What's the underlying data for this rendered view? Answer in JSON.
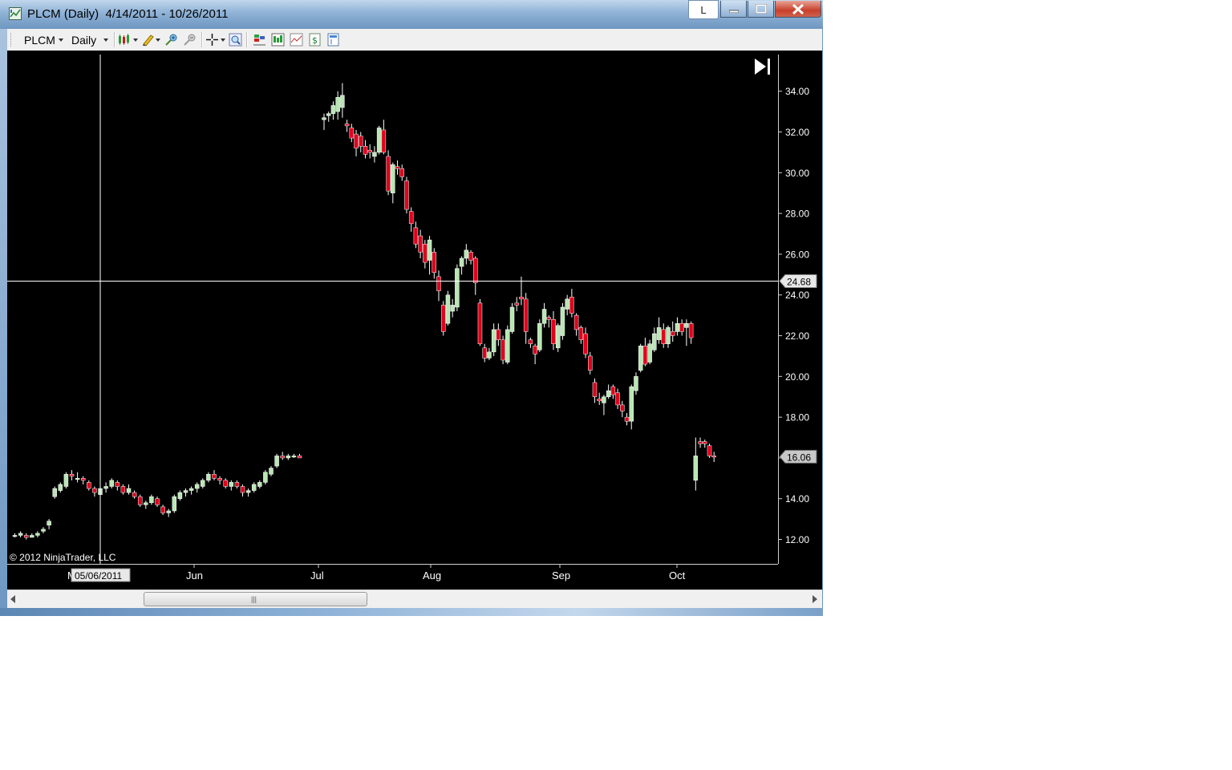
{
  "window": {
    "title": "PLCM (Daily)  4/14/2011 - 10/26/2011",
    "l_button_label": "L"
  },
  "toolbar": {
    "instrument": "PLCM",
    "interval": "Daily",
    "icons": [
      "chart-style-icon",
      "drawing-tools-icon",
      "zoom-in-icon",
      "zoom-out-icon",
      "crosshair-icon",
      "magnifier-icon",
      "strategies-icon",
      "indicators-icon",
      "data-series-icon",
      "dollar-icon",
      "properties-icon"
    ]
  },
  "chart": {
    "copyright": "© 2012 NinjaTrader, LLC",
    "crosshair_price_label": "24.68",
    "last_price_label": "16.06",
    "crosshair_date_label": "05/06/2011",
    "partial_month_label": "M",
    "jump_to_end_icon": "skip-to-end-icon",
    "colors": {
      "background": "#000000",
      "up_candle": "#b9e6b4",
      "down_candle": "#e0001b",
      "grid_text": "#ffffff"
    }
  },
  "chart_data": {
    "type": "candlestick",
    "title": "",
    "xlabel": "",
    "ylabel": "",
    "ylim": [
      10.8,
      35.8
    ],
    "x_tick_labels": [
      "Jun",
      "Jul",
      "Aug",
      "Sep",
      "Oct"
    ],
    "y_ticks": [
      "12.00",
      "14.00",
      "16.00",
      "18.00",
      "20.00",
      "22.00",
      "24.00",
      "26.00",
      "28.00",
      "30.00",
      "32.00",
      "34.00"
    ],
    "grid": false,
    "bars": [
      [
        12.2,
        12.3,
        12.1,
        12.2
      ],
      [
        12.2,
        12.4,
        12.1,
        12.3
      ],
      [
        12.2,
        12.3,
        12.0,
        12.1
      ],
      [
        12.1,
        12.3,
        12.1,
        12.2
      ],
      [
        12.2,
        12.4,
        12.1,
        12.3
      ],
      [
        12.4,
        12.6,
        12.3,
        12.5
      ],
      [
        12.7,
        13.0,
        12.5,
        12.9
      ],
      [
        14.1,
        14.6,
        14.0,
        14.5
      ],
      [
        14.4,
        14.8,
        14.3,
        14.7
      ],
      [
        14.6,
        15.3,
        14.5,
        15.2
      ],
      [
        15.2,
        15.4,
        14.9,
        15.1
      ],
      [
        15.0,
        15.3,
        14.8,
        15.0
      ],
      [
        15.0,
        15.1,
        14.7,
        14.9
      ],
      [
        14.8,
        14.9,
        14.4,
        14.5
      ],
      [
        14.5,
        14.6,
        14.1,
        14.3
      ],
      [
        14.2,
        14.6,
        14.0,
        14.5
      ],
      [
        14.5,
        14.8,
        14.3,
        14.6
      ],
      [
        14.6,
        15.0,
        14.5,
        14.9
      ],
      [
        14.8,
        14.9,
        14.4,
        14.6
      ],
      [
        14.6,
        14.7,
        14.2,
        14.3
      ],
      [
        14.3,
        14.7,
        14.2,
        14.5
      ],
      [
        14.3,
        14.4,
        14.0,
        14.1
      ],
      [
        14.1,
        14.2,
        13.6,
        13.7
      ],
      [
        13.7,
        13.9,
        13.5,
        13.8
      ],
      [
        13.8,
        14.2,
        13.7,
        14.1
      ],
      [
        14.0,
        14.1,
        13.6,
        13.7
      ],
      [
        13.6,
        13.7,
        13.2,
        13.3
      ],
      [
        13.3,
        13.5,
        13.1,
        13.4
      ],
      [
        13.4,
        14.2,
        13.3,
        14.1
      ],
      [
        14.0,
        14.4,
        13.9,
        14.3
      ],
      [
        14.3,
        14.5,
        14.1,
        14.4
      ],
      [
        14.4,
        14.6,
        14.2,
        14.5
      ],
      [
        14.5,
        14.8,
        14.3,
        14.7
      ],
      [
        14.6,
        15.0,
        14.5,
        14.9
      ],
      [
        14.9,
        15.3,
        14.8,
        15.2
      ],
      [
        15.2,
        15.4,
        14.9,
        15.0
      ],
      [
        15.0,
        15.1,
        14.7,
        14.9
      ],
      [
        14.9,
        15.0,
        14.5,
        14.6
      ],
      [
        14.6,
        14.9,
        14.4,
        14.8
      ],
      [
        14.8,
        14.9,
        14.5,
        14.6
      ],
      [
        14.6,
        14.7,
        14.1,
        14.3
      ],
      [
        14.3,
        14.5,
        14.1,
        14.4
      ],
      [
        14.4,
        14.8,
        14.3,
        14.7
      ],
      [
        14.6,
        14.9,
        14.5,
        14.8
      ],
      [
        14.8,
        15.4,
        14.7,
        15.3
      ],
      [
        15.2,
        15.6,
        15.1,
        15.5
      ],
      [
        15.6,
        16.2,
        15.5,
        16.1
      ],
      [
        16.1,
        16.3,
        15.9,
        16.0
      ],
      [
        16.0,
        16.2,
        15.9,
        16.1
      ],
      [
        16.1,
        16.2,
        16.0,
        16.1
      ],
      [
        16.1,
        16.2,
        16.0,
        16.0
      ],
      [
        32.6,
        32.9,
        32.1,
        32.7
      ],
      [
        32.8,
        33.0,
        32.5,
        32.9
      ],
      [
        32.9,
        33.5,
        32.6,
        33.3
      ],
      [
        33.0,
        34.0,
        32.6,
        33.7
      ],
      [
        33.2,
        34.4,
        32.7,
        33.8
      ],
      [
        32.4,
        32.6,
        32.0,
        32.3
      ],
      [
        32.2,
        32.4,
        31.5,
        31.7
      ],
      [
        31.9,
        32.1,
        30.8,
        31.2
      ],
      [
        31.8,
        32.0,
        31.0,
        31.3
      ],
      [
        31.3,
        31.6,
        30.7,
        30.9
      ],
      [
        31.1,
        31.4,
        30.7,
        31.0
      ],
      [
        30.8,
        31.3,
        30.5,
        31.0
      ],
      [
        31.0,
        32.3,
        30.9,
        32.2
      ],
      [
        32.1,
        32.6,
        30.9,
        31.0
      ],
      [
        30.8,
        31.1,
        28.9,
        29.1
      ],
      [
        29.0,
        30.5,
        28.5,
        30.4
      ],
      [
        30.3,
        30.6,
        29.9,
        30.2
      ],
      [
        30.2,
        30.4,
        29.6,
        29.8
      ],
      [
        29.6,
        29.8,
        28.0,
        28.2
      ],
      [
        28.1,
        28.3,
        27.1,
        27.5
      ],
      [
        27.3,
        27.6,
        26.3,
        26.5
      ],
      [
        26.9,
        27.2,
        25.8,
        26.1
      ],
      [
        26.5,
        26.7,
        25.3,
        25.6
      ],
      [
        25.7,
        26.9,
        25.0,
        26.7
      ],
      [
        26.1,
        26.3,
        24.8,
        25.1
      ],
      [
        24.9,
        25.2,
        23.7,
        24.2
      ],
      [
        23.5,
        23.7,
        22.0,
        22.2
      ],
      [
        22.6,
        24.2,
        22.5,
        24.0
      ],
      [
        23.2,
        23.8,
        22.9,
        23.5
      ],
      [
        23.4,
        25.5,
        23.2,
        25.3
      ],
      [
        25.4,
        25.9,
        25.0,
        25.8
      ],
      [
        25.8,
        26.5,
        25.5,
        26.2
      ],
      [
        26.1,
        26.2,
        25.5,
        25.7
      ],
      [
        25.8,
        25.9,
        24.0,
        24.6
      ],
      [
        23.6,
        23.8,
        21.5,
        21.6
      ],
      [
        21.4,
        21.6,
        20.7,
        20.9
      ],
      [
        20.9,
        21.4,
        20.8,
        21.2
      ],
      [
        21.2,
        22.6,
        21.0,
        22.3
      ],
      [
        22.3,
        22.6,
        21.5,
        21.8
      ],
      [
        21.8,
        22.0,
        20.6,
        20.8
      ],
      [
        20.7,
        22.5,
        20.6,
        22.3
      ],
      [
        22.2,
        23.6,
        22.1,
        23.4
      ],
      [
        23.6,
        23.9,
        23.2,
        23.5
      ],
      [
        23.9,
        24.9,
        23.5,
        23.8
      ],
      [
        23.8,
        24.1,
        21.6,
        22.2
      ],
      [
        21.8,
        21.9,
        21.4,
        21.6
      ],
      [
        21.5,
        21.6,
        20.6,
        21.1
      ],
      [
        21.3,
        22.8,
        21.2,
        22.6
      ],
      [
        22.6,
        23.6,
        22.4,
        23.3
      ],
      [
        22.9,
        23.0,
        22.4,
        22.8
      ],
      [
        22.8,
        23.2,
        21.3,
        21.6
      ],
      [
        21.4,
        22.6,
        21.2,
        22.5
      ],
      [
        22.0,
        23.6,
        21.8,
        23.4
      ],
      [
        23.3,
        24.0,
        23.0,
        23.8
      ],
      [
        23.9,
        24.3,
        22.9,
        23.1
      ],
      [
        23.0,
        23.1,
        22.0,
        22.3
      ],
      [
        22.4,
        22.5,
        21.6,
        21.8
      ],
      [
        22.1,
        22.4,
        20.9,
        21.1
      ],
      [
        21.0,
        21.2,
        20.1,
        20.3
      ],
      [
        19.7,
        19.9,
        18.7,
        19.0
      ],
      [
        18.9,
        19.2,
        18.6,
        18.8
      ],
      [
        18.7,
        19.1,
        18.1,
        19.0
      ],
      [
        19.0,
        19.6,
        18.9,
        19.3
      ],
      [
        19.5,
        19.6,
        18.9,
        19.1
      ],
      [
        19.2,
        19.4,
        18.4,
        18.6
      ],
      [
        18.6,
        18.8,
        18.0,
        18.3
      ],
      [
        18.0,
        18.2,
        17.6,
        17.8
      ],
      [
        17.8,
        19.6,
        17.4,
        19.5
      ],
      [
        19.3,
        20.2,
        19.1,
        20.0
      ],
      [
        20.3,
        21.6,
        20.2,
        21.5
      ],
      [
        21.5,
        21.9,
        20.5,
        20.6
      ],
      [
        20.7,
        21.8,
        20.6,
        21.6
      ],
      [
        21.3,
        22.4,
        21.2,
        22.1
      ],
      [
        21.8,
        22.9,
        21.6,
        22.4
      ],
      [
        22.3,
        22.6,
        21.4,
        21.6
      ],
      [
        21.6,
        22.5,
        21.4,
        22.4
      ],
      [
        22.2,
        22.7,
        21.7,
        22.0
      ],
      [
        22.2,
        22.9,
        22.0,
        22.6
      ],
      [
        22.6,
        22.8,
        22.0,
        22.2
      ],
      [
        22.4,
        22.8,
        21.5,
        22.6
      ],
      [
        22.6,
        22.7,
        21.6,
        21.9
      ],
      [
        14.9,
        17.0,
        14.4,
        16.1
      ],
      [
        16.8,
        17.0,
        16.5,
        16.7
      ],
      [
        16.8,
        16.9,
        16.5,
        16.7
      ],
      [
        16.6,
        16.7,
        16.0,
        16.1
      ],
      [
        16.1,
        16.3,
        15.8,
        16.06
      ]
    ]
  }
}
